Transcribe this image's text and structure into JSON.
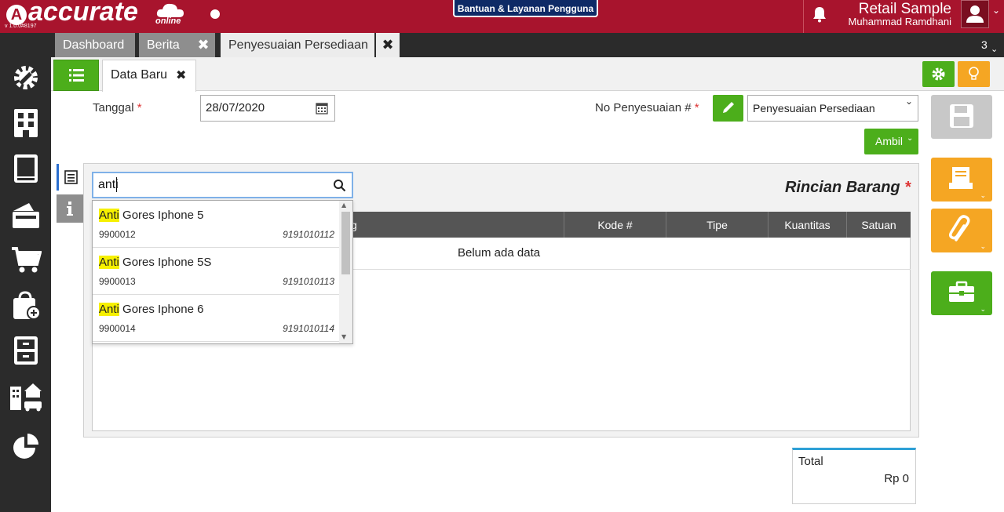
{
  "app": {
    "logo_text": "accurate",
    "logo_sub": "online",
    "version": "v 1.0.0#8197",
    "help_button": "Bantuan & Layanan Pengguna",
    "company": "Retail Sample",
    "user": "Muhammad Ramdhani"
  },
  "tabs": [
    {
      "label": "Dashboard",
      "active": false,
      "closable": false
    },
    {
      "label": "Berita",
      "active": false,
      "closable": true
    },
    {
      "label": "Penyesuaian Persediaan",
      "active": true,
      "closable": true
    }
  ],
  "tab_count": "3",
  "sidebar": {
    "icons": [
      "settings-icon",
      "company-icon",
      "ledger-icon",
      "cash-bank-icon",
      "sales-cart-icon",
      "purchase-bag-icon",
      "inventory-icon",
      "assets-icon",
      "report-chart-icon"
    ]
  },
  "subheader": {
    "doc_tab_label": "Data Baru"
  },
  "form": {
    "tanggal_label": "Tanggal",
    "tanggal_value": "28/07/2020",
    "no_label": "No Penyesuaian #",
    "no_select_value": "Penyesuaian Persediaan",
    "ambil_button": "Ambil",
    "required_mark": "*"
  },
  "detail": {
    "title": "Rincian Barang",
    "columns": [
      "g",
      "Kode #",
      "Tipe",
      "Kuantitas",
      "Satuan"
    ],
    "empty_message": "Belum ada data"
  },
  "search": {
    "value": "anti",
    "results": [
      {
        "highlight": "Anti",
        "rest": " Gores Iphone 5",
        "code": "9900012",
        "barcode": "9191010112"
      },
      {
        "highlight": "Anti",
        "rest": " Gores Iphone 5S",
        "code": "9900013",
        "barcode": "9191010113"
      },
      {
        "highlight": "Anti",
        "rest": " Gores Iphone 6",
        "code": "9900014",
        "barcode": "9191010114"
      }
    ]
  },
  "total": {
    "label": "Total",
    "value": "Rp 0"
  },
  "colors": {
    "brand": "#a8142d",
    "green": "#4cae1b",
    "orange": "#f5a623",
    "sidebar": "#2b2b2b"
  }
}
